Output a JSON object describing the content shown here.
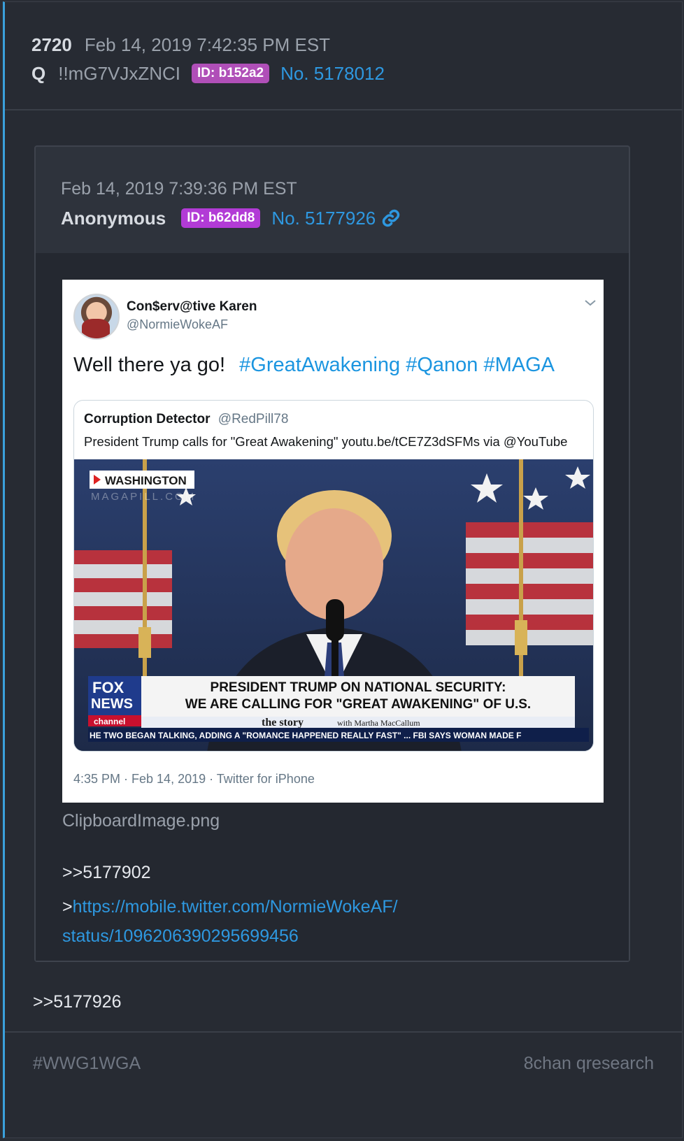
{
  "post": {
    "number": "2720",
    "date": "Feb 14, 2019 7:42:35 PM EST",
    "name": "Q",
    "trip": "!!mG7VJxZNCI",
    "id": "ID: b152a2",
    "post_no": "No. 5178012",
    "reply_ref": ">>5177926"
  },
  "quoted": {
    "date": "Feb 14, 2019 7:39:36 PM EST",
    "name": "Anonymous",
    "id": "ID: b62dd8",
    "post_no": "No. 5177926",
    "link_icon": "link-icon",
    "filename": "ClipboardImage.png",
    "reply_ref": ">>5177902",
    "greentext_prefix": ">",
    "url_part1": "https://mobile.twitter.com/NormieWokeAF/",
    "url_part2": "status/1096206390295699456"
  },
  "tweet": {
    "display_name": "Con$erv@tive Karen",
    "handle": "@NormieWokeAF",
    "text": "Well there ya go!",
    "hashtags": "#GreatAwakening #Qanon #MAGA",
    "footer": "4:35 PM · Feb 14, 2019 · Twitter for iPhone",
    "embedded": {
      "name": "Corruption Detector",
      "handle": "@RedPill78",
      "text": "President Trump calls for \"Great Awakening\" youtu.be/tCE7Z3dSFMs via @YouTube",
      "image": {
        "location_tag": "WASHINGTON",
        "watermark": "MAGAPILL.COM",
        "logo_line1": "FOX",
        "logo_line2": "NEWS",
        "logo_line3": "channel",
        "headline1": "PRESIDENT TRUMP ON NATIONAL SECURITY:",
        "headline2": "WE ARE CALLING FOR \"GREAT AWAKENING\" OF U.S.",
        "show": "the story",
        "show_host": "with Martha MacCallum",
        "ticker": "HE TWO BEGAN TALKING, ADDING A \"ROMANCE HAPPENED REALLY FAST\" ...  FBI SAYS WOMAN MADE F"
      }
    }
  },
  "footer": {
    "tag": "#WWG1WGA",
    "source": "8chan qresearch"
  },
  "colors": {
    "accent": "#2e98e0",
    "id_badge_q": "#b04fb8",
    "id_badge_anon": "#b23bd6",
    "border_accent": "#3aa0dc"
  }
}
